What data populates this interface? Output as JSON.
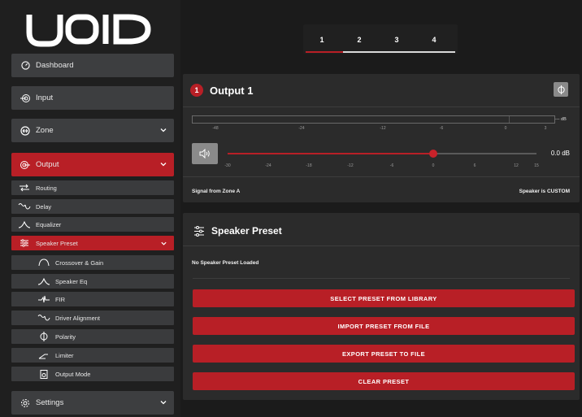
{
  "brand": {
    "logo_text": "VOID",
    "accent": "#b81f26"
  },
  "sidebar": {
    "dashboard": {
      "label": "Dashboard",
      "icon": "dashboard-icon"
    },
    "input": {
      "label": "Input",
      "icon": "input-icon"
    },
    "zone": {
      "label": "Zone",
      "icon": "zone-icon"
    },
    "output": {
      "label": "Output",
      "icon": "output-icon"
    },
    "output_items": [
      {
        "label": "Routing",
        "icon": "routing-icon"
      },
      {
        "label": "Delay",
        "icon": "delay-icon"
      },
      {
        "label": "Equalizer",
        "icon": "equalizer-icon"
      },
      {
        "label": "Speaker Preset",
        "icon": "speaker-preset-icon"
      }
    ],
    "preset_items": [
      {
        "label": "Crossover & Gain",
        "icon": "crossover-icon"
      },
      {
        "label": "Speaker Eq",
        "icon": "speaker-eq-icon"
      },
      {
        "label": "FIR",
        "icon": "fir-icon"
      },
      {
        "label": "Driver Alignment",
        "icon": "driver-alignment-icon"
      },
      {
        "label": "Polarity",
        "icon": "polarity-icon"
      },
      {
        "label": "Limiter",
        "icon": "limiter-icon"
      },
      {
        "label": "Output Mode",
        "icon": "output-mode-icon"
      }
    ],
    "settings": {
      "label": "Settings",
      "icon": "settings-icon"
    }
  },
  "tabs": [
    "1",
    "2",
    "3",
    "4"
  ],
  "output_panel": {
    "badge": "1",
    "title": "Output 1",
    "meter_unit": "--- dB",
    "meter_ticks": [
      "-48",
      "-24",
      "-12",
      "-6",
      "0",
      "3"
    ],
    "gain_ticks": [
      "-30",
      "-24",
      "-18",
      "-12",
      "-6",
      "0",
      "6",
      "12",
      "15"
    ],
    "gain_value": "0.0 dB",
    "gain_level_db": 0,
    "signal_source": "Signal from Zone A",
    "speaker_status": "Speaker is CUSTOM"
  },
  "preset_panel": {
    "title": "Speaker Preset",
    "status": "No Speaker Preset Loaded",
    "buttons": [
      "SELECT PRESET FROM LIBRARY",
      "IMPORT PRESET FROM FILE",
      "EXPORT PRESET TO FILE",
      "CLEAR PRESET"
    ]
  }
}
